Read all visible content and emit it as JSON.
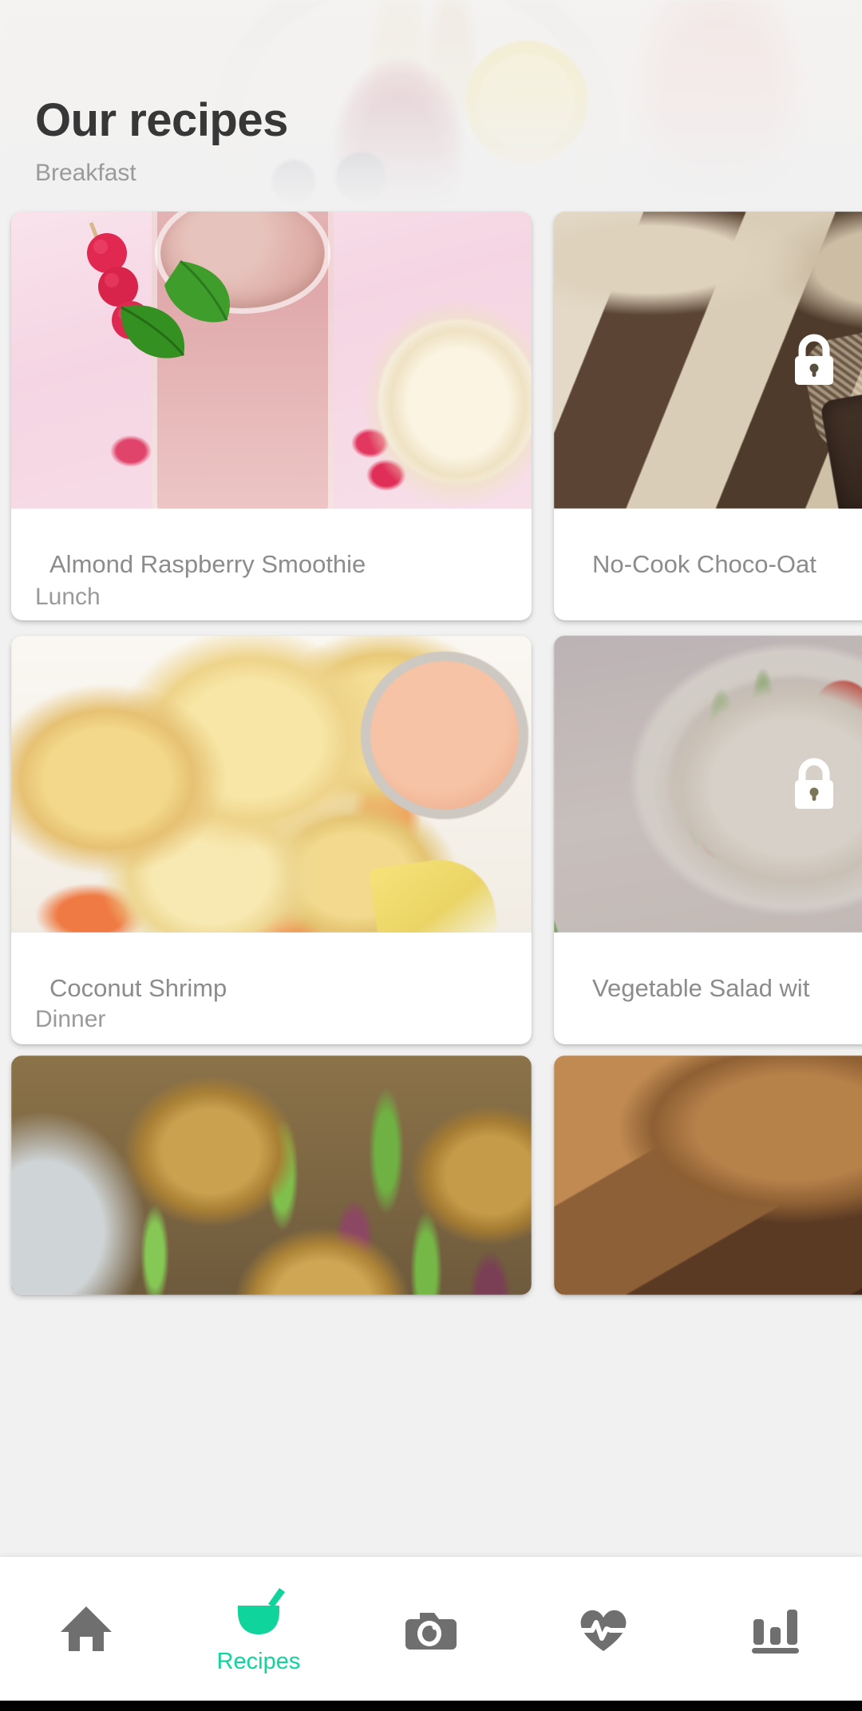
{
  "header": {
    "title": "Our recipes"
  },
  "sections": [
    {
      "label": "Breakfast",
      "cards": [
        {
          "title": "Almond Raspberry Smoothie",
          "locked": false,
          "image": "almond-raspberry-smoothie-photo"
        },
        {
          "title": "No-Cook Choco-Oat",
          "locked": true,
          "image": "no-cook-choco-oat-bars-photo"
        }
      ]
    },
    {
      "label": "Lunch",
      "cards": [
        {
          "title": "Coconut Shrimp",
          "locked": false,
          "image": "coconut-shrimp-photo"
        },
        {
          "title": "Vegetable Salad wit",
          "locked": true,
          "image": "vegetable-salad-photo"
        }
      ]
    },
    {
      "label": "Dinner",
      "cards": [
        {
          "title": "",
          "locked": false,
          "image": "falafel-salad-photo"
        },
        {
          "title": "",
          "locked": false,
          "image": "burger-blue-cheese-photo"
        }
      ]
    }
  ],
  "bottom_nav": {
    "active_index": 1,
    "accent_color": "#0fd49c",
    "inactive_color": "#6f6f6f",
    "items": [
      {
        "icon": "home-icon",
        "label": ""
      },
      {
        "icon": "mortar-pestle-icon",
        "label": "Recipes"
      },
      {
        "icon": "camera-icon",
        "label": ""
      },
      {
        "icon": "heart-pulse-icon",
        "label": ""
      },
      {
        "icon": "bar-chart-icon",
        "label": ""
      }
    ]
  },
  "colors": {
    "page_background": "#f1f1f1",
    "card_background": "#ffffff",
    "title_text": "#373737",
    "section_text": "#9a9a9a",
    "card_title_text": "#8c8c8c",
    "lock_icon": "#ffffff"
  }
}
